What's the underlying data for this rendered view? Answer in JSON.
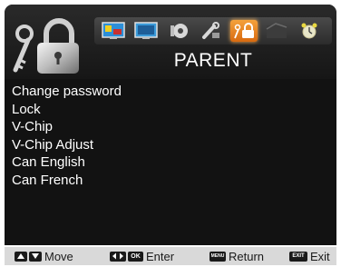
{
  "menu": {
    "title": "PARENT",
    "icons": [
      {
        "name": "picture-icon",
        "active": false
      },
      {
        "name": "screen-icon",
        "active": false
      },
      {
        "name": "sound-icon",
        "active": false
      },
      {
        "name": "tools-icon",
        "active": false
      },
      {
        "name": "parental-lock-icon",
        "active": true
      },
      {
        "name": "channel-icon",
        "active": false
      },
      {
        "name": "timer-icon",
        "active": false
      }
    ],
    "active_color": "#f08a24"
  },
  "items": [
    {
      "label": "Change password"
    },
    {
      "label": "Lock"
    },
    {
      "label": "V-Chip"
    },
    {
      "label": "V-Chip Adjust"
    },
    {
      "label": "Can English"
    },
    {
      "label": "Can French"
    }
  ],
  "footer": {
    "move": {
      "label": "Move"
    },
    "enter": {
      "ok_key": "OK",
      "label": "Enter"
    },
    "return": {
      "key": "MENU",
      "label": "Return"
    },
    "exit": {
      "key": "EXIT",
      "label": "Exit"
    }
  }
}
